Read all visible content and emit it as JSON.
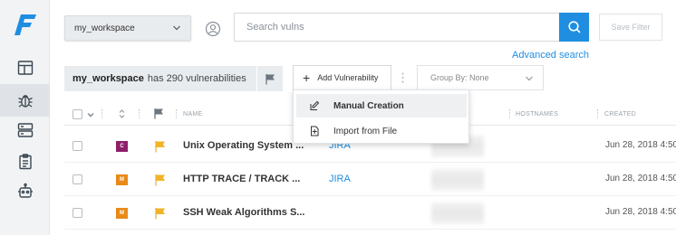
{
  "sidebar": {
    "logo_letter": "F",
    "items": [
      {
        "icon": "layout-icon"
      },
      {
        "icon": "bug-icon",
        "active": true
      },
      {
        "icon": "server-icon"
      },
      {
        "icon": "clipboard-icon"
      },
      {
        "icon": "robot-icon"
      }
    ]
  },
  "topbar": {
    "workspace_select": "my_workspace",
    "search_placeholder": "Search vulns",
    "save_filter_label": "Save Filter",
    "advanced_search_label": "Advanced search"
  },
  "toolbar": {
    "workspace_name": "my_workspace",
    "vuln_count_text": "has 290 vulnerabilities",
    "add_vulnerability_label": "Add Vulnerability",
    "group_by_label": "Group By: None"
  },
  "add_menu": {
    "items": [
      {
        "label": "Manual Creation",
        "icon": "manual-create-icon"
      },
      {
        "label": "Import from File",
        "icon": "import-file-icon"
      }
    ]
  },
  "table": {
    "columns": {
      "name": "NAME",
      "hostnames": "HOSTNAMES",
      "created": "CREATED"
    },
    "rows": [
      {
        "severity": "C",
        "severity_color": "#8e1f6b",
        "name": "Unix Operating System ...",
        "issue_tracker": "JIRA",
        "created": "Jun 28, 2018 4:50"
      },
      {
        "severity": "M",
        "severity_color": "#e88a1a",
        "name": "HTTP TRACE / TRACK ...",
        "issue_tracker": "JIRA",
        "created": "Jun 28, 2018 4:50"
      },
      {
        "severity": "M",
        "severity_color": "#e88a1a",
        "name": "SSH Weak Algorithms S...",
        "issue_tracker": "",
        "created": "Jun 28, 2018 4:50"
      }
    ]
  },
  "colors": {
    "accent": "#1f8ee0",
    "flag": "#f0b429",
    "critical": "#8e1f6b",
    "medium": "#e88a1a"
  }
}
